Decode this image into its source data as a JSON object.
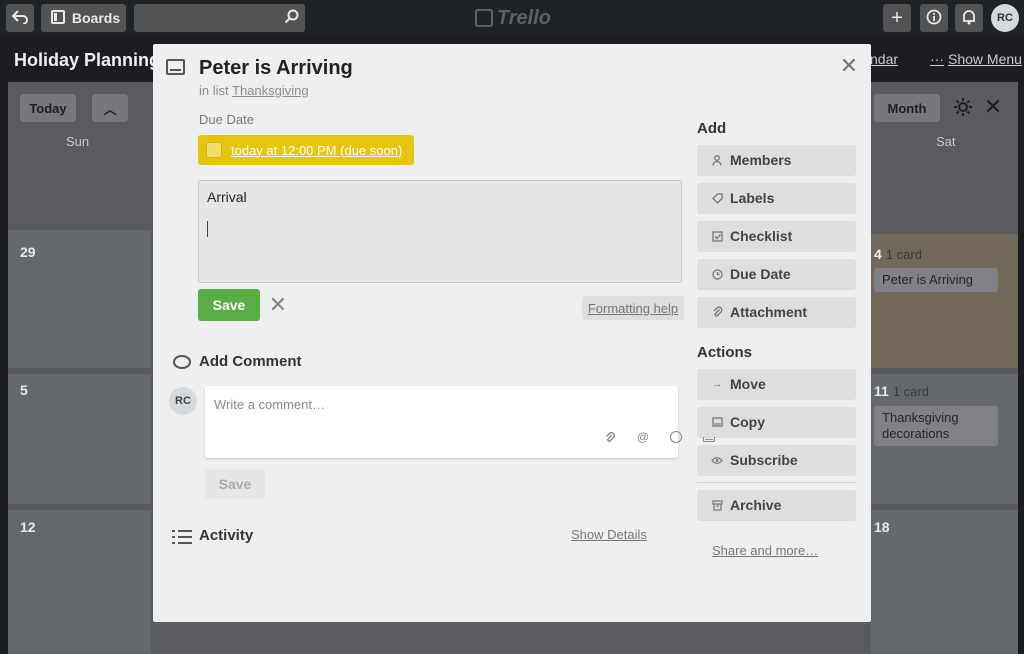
{
  "topbar": {
    "back_icon": "arrow-back-icon",
    "boards_label": "Boards",
    "search_placeholder": "",
    "logo_text": "Trello",
    "avatar_initials": "RC"
  },
  "board": {
    "title": "Holiday Planning",
    "calendar_link": "ndar",
    "show_menu": "Show Menu"
  },
  "calendar": {
    "today_label": "Today",
    "month_label": "Month",
    "days": [
      "Sun",
      "Sat"
    ],
    "rows": [
      {
        "sun": "29",
        "sat": "4",
        "sat_count": "1 card",
        "sat_card": "Peter is Arriving"
      },
      {
        "sun": "5",
        "sat": "11",
        "sat_count": "1 card",
        "sat_card": "Thanksgiving decorations"
      },
      {
        "sun": "12",
        "sat": "18"
      }
    ]
  },
  "card": {
    "title": "Peter is Arriving",
    "list_prefix": "in list",
    "list_name": "Thanksgiving",
    "due_label": "Due Date",
    "due_text": "today at 12:00 PM (due soon)",
    "description": "Arrival",
    "save_label": "Save",
    "formatting_help": "Formatting help",
    "add_comment_title": "Add Comment",
    "comment_avatar": "RC",
    "comment_placeholder": "Write a comment…",
    "comment_save": "Save",
    "activity_title": "Activity",
    "show_details": "Show Details"
  },
  "sidebar": {
    "add_title": "Add",
    "add_items": [
      {
        "label": "Members",
        "icon": "person-icon"
      },
      {
        "label": "Labels",
        "icon": "tag-icon"
      },
      {
        "label": "Checklist",
        "icon": "checkbox-icon"
      },
      {
        "label": "Due Date",
        "icon": "clock-icon"
      },
      {
        "label": "Attachment",
        "icon": "paperclip-icon"
      }
    ],
    "actions_title": "Actions",
    "action_items": [
      {
        "label": "Move",
        "icon": "arrow-right-icon"
      },
      {
        "label": "Copy",
        "icon": "card-icon"
      },
      {
        "label": "Subscribe",
        "icon": "eye-icon"
      },
      {
        "label": "Archive",
        "icon": "archive-icon"
      }
    ],
    "share_more": "Share and more…"
  },
  "colors": {
    "due_soon": "#e6c60d",
    "save_green": "#5aac44"
  }
}
